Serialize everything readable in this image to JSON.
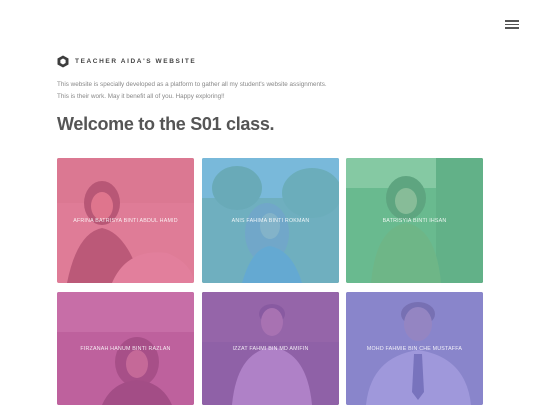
{
  "header": {
    "brand": "TEACHER AIDA'S WEBSITE",
    "menu_icon": "hamburger-icon",
    "logo_icon": "hexagon-logo-icon"
  },
  "intro": {
    "line1": "This website is specially developed as a platform to gather all my student's website assignments.",
    "line2": "This is their work. May it benefit all of you. Happy exploring!!"
  },
  "main": {
    "title": "Welcome to the S01 class."
  },
  "students": [
    {
      "name": "AFRINA BATRISYA BINTI ABDUL HAMID",
      "tint": "#e0668e"
    },
    {
      "name": "ANIS FAHIMA BINTI ROKMAN",
      "tint": "#6fb7d8"
    },
    {
      "name": "BATRISYIA BINTI IHSAN",
      "tint": "#6fc49c"
    },
    {
      "name": "FIRZANAH HANUM BINTI RAZLAN",
      "tint": "#c25a9c"
    },
    {
      "name": "IZZAT FAHMI BIN MD AMIFIN",
      "tint": "#a46cc4"
    },
    {
      "name": "MOHD FAHMIE BIN CHE MUSTAFFA",
      "tint": "#8c84d6"
    }
  ]
}
